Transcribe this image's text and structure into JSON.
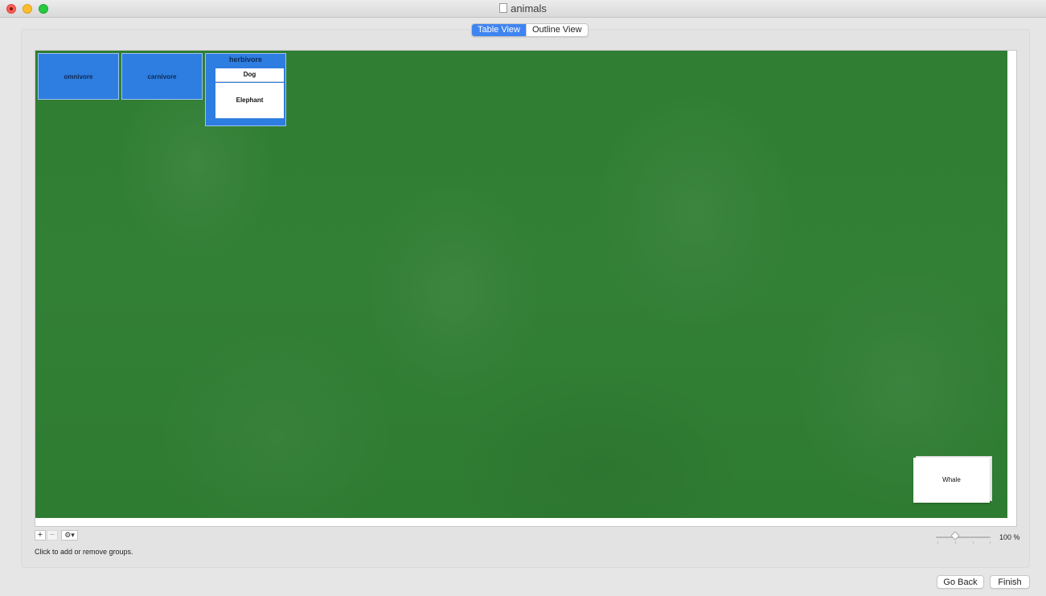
{
  "window": {
    "title": "animals"
  },
  "view_switch": {
    "tabs": [
      "Table View",
      "Outline View"
    ],
    "selected": "Table View"
  },
  "groups": [
    {
      "label": "omnivore",
      "cards": []
    },
    {
      "label": "carnivore",
      "cards": []
    },
    {
      "label": "herbivore",
      "cards": [
        "Dog",
        "Elephant"
      ]
    }
  ],
  "ungrouped_cards": [
    "Whale"
  ],
  "controls": {
    "add_symbol": "+",
    "remove_symbol": "−",
    "gear_symbol": "⚙▾",
    "hint": "Click to add or remove groups.",
    "zoom_label": "100 %",
    "zoom_value_percent": 100
  },
  "footer": {
    "go_back": "Go Back",
    "finish": "Finish"
  },
  "colors": {
    "felt": "#2f7f34",
    "group": "#2e7de0",
    "accent": "#3f84f0"
  }
}
